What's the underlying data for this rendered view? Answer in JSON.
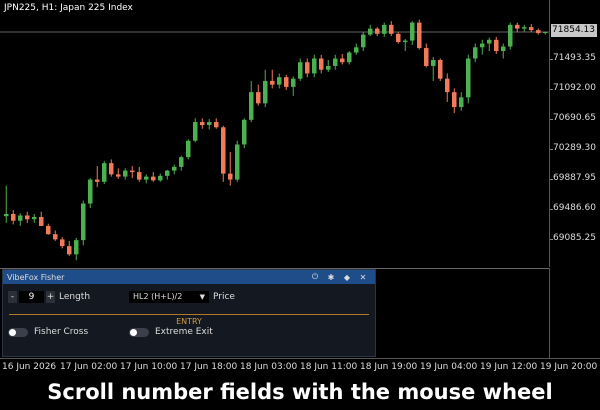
{
  "chart": {
    "title": "JPN225, H1:  Japan 225 Index",
    "current_price": "71854.13",
    "price_levels": [
      "71493.35",
      "71092.00",
      "70690.65",
      "70289.30",
      "69887.95",
      "69486.60",
      "69085.25"
    ],
    "time_labels": [
      "16 Jun 2026",
      "17 Jun 02:00",
      "17 Jun 10:00",
      "17 Jun 18:00",
      "18 Jun 03:00",
      "18 Jun 11:00",
      "18 Jun 19:00",
      "19 Jun 04:00",
      "19 Jun 12:00",
      "19 Jun 20:00"
    ],
    "bull_color": "#4caf50",
    "bear_color": "#f07a5a",
    "candles": [
      {
        "o": 69390,
        "h": 69800,
        "l": 69300,
        "c": 69420
      },
      {
        "o": 69420,
        "h": 69470,
        "l": 69280,
        "c": 69330
      },
      {
        "o": 69330,
        "h": 69430,
        "l": 69260,
        "c": 69400
      },
      {
        "o": 69400,
        "h": 69450,
        "l": 69300,
        "c": 69350
      },
      {
        "o": 69350,
        "h": 69420,
        "l": 69300,
        "c": 69380
      },
      {
        "o": 69380,
        "h": 69450,
        "l": 69320,
        "c": 69260
      },
      {
        "o": 69260,
        "h": 69290,
        "l": 69140,
        "c": 69150
      },
      {
        "o": 69150,
        "h": 69200,
        "l": 69060,
        "c": 69080
      },
      {
        "o": 69080,
        "h": 69110,
        "l": 68960,
        "c": 68990
      },
      {
        "o": 68990,
        "h": 69060,
        "l": 68860,
        "c": 68880
      },
      {
        "o": 68880,
        "h": 69100,
        "l": 68800,
        "c": 69070
      },
      {
        "o": 69070,
        "h": 69600,
        "l": 69000,
        "c": 69560
      },
      {
        "o": 69560,
        "h": 69900,
        "l": 69500,
        "c": 69880
      },
      {
        "o": 69880,
        "h": 70060,
        "l": 69780,
        "c": 69850
      },
      {
        "o": 69850,
        "h": 70130,
        "l": 69820,
        "c": 70100
      },
      {
        "o": 70100,
        "h": 70150,
        "l": 69920,
        "c": 69950
      },
      {
        "o": 69950,
        "h": 70030,
        "l": 69890,
        "c": 69920
      },
      {
        "o": 69920,
        "h": 70030,
        "l": 69880,
        "c": 70000
      },
      {
        "o": 70000,
        "h": 70060,
        "l": 69900,
        "c": 69980
      },
      {
        "o": 69980,
        "h": 70050,
        "l": 69850,
        "c": 69880
      },
      {
        "o": 69880,
        "h": 69950,
        "l": 69830,
        "c": 69920
      },
      {
        "o": 69920,
        "h": 69980,
        "l": 69850,
        "c": 69870
      },
      {
        "o": 69870,
        "h": 69960,
        "l": 69850,
        "c": 69930
      },
      {
        "o": 69930,
        "h": 70010,
        "l": 69880,
        "c": 70000
      },
      {
        "o": 70000,
        "h": 70080,
        "l": 69950,
        "c": 70050
      },
      {
        "o": 70050,
        "h": 70200,
        "l": 70000,
        "c": 70180
      },
      {
        "o": 70180,
        "h": 70420,
        "l": 70150,
        "c": 70400
      },
      {
        "o": 70400,
        "h": 70700,
        "l": 70380,
        "c": 70650
      },
      {
        "o": 70650,
        "h": 70700,
        "l": 70560,
        "c": 70610
      },
      {
        "o": 70610,
        "h": 70690,
        "l": 70550,
        "c": 70650
      },
      {
        "o": 70650,
        "h": 70700,
        "l": 70560,
        "c": 70580
      },
      {
        "o": 70580,
        "h": 70600,
        "l": 69850,
        "c": 69960
      },
      {
        "o": 69960,
        "h": 70250,
        "l": 69800,
        "c": 69880
      },
      {
        "o": 69880,
        "h": 70400,
        "l": 69850,
        "c": 70350
      },
      {
        "o": 70350,
        "h": 70700,
        "l": 70300,
        "c": 70680
      },
      {
        "o": 70680,
        "h": 71200,
        "l": 70650,
        "c": 71050
      },
      {
        "o": 71050,
        "h": 71150,
        "l": 70870,
        "c": 70900
      },
      {
        "o": 70900,
        "h": 71350,
        "l": 70850,
        "c": 71200
      },
      {
        "o": 71200,
        "h": 71350,
        "l": 71100,
        "c": 71150
      },
      {
        "o": 71150,
        "h": 71300,
        "l": 71100,
        "c": 71250
      },
      {
        "o": 71250,
        "h": 71280,
        "l": 71080,
        "c": 71120
      },
      {
        "o": 71120,
        "h": 71260,
        "l": 71000,
        "c": 71230
      },
      {
        "o": 71230,
        "h": 71500,
        "l": 71200,
        "c": 71450
      },
      {
        "o": 71450,
        "h": 71500,
        "l": 71250,
        "c": 71300
      },
      {
        "o": 71300,
        "h": 71550,
        "l": 71250,
        "c": 71500
      },
      {
        "o": 71500,
        "h": 71550,
        "l": 71300,
        "c": 71350
      },
      {
        "o": 71350,
        "h": 71480,
        "l": 71320,
        "c": 71400
      },
      {
        "o": 71400,
        "h": 71550,
        "l": 71350,
        "c": 71500
      },
      {
        "o": 71500,
        "h": 71560,
        "l": 71420,
        "c": 71450
      },
      {
        "o": 71450,
        "h": 71600,
        "l": 71420,
        "c": 71580
      },
      {
        "o": 71580,
        "h": 71700,
        "l": 71550,
        "c": 71650
      },
      {
        "o": 71650,
        "h": 71860,
        "l": 71600,
        "c": 71820
      },
      {
        "o": 71820,
        "h": 71950,
        "l": 71800,
        "c": 71900
      },
      {
        "o": 71900,
        "h": 71920,
        "l": 71800,
        "c": 71830
      },
      {
        "o": 71830,
        "h": 71980,
        "l": 71790,
        "c": 71950
      },
      {
        "o": 71950,
        "h": 72000,
        "l": 71800,
        "c": 71830
      },
      {
        "o": 71830,
        "h": 71850,
        "l": 71700,
        "c": 71720
      },
      {
        "o": 71720,
        "h": 71760,
        "l": 71600,
        "c": 71740
      },
      {
        "o": 71740,
        "h": 72000,
        "l": 71680,
        "c": 71980
      },
      {
        "o": 71980,
        "h": 72020,
        "l": 71620,
        "c": 71640
      },
      {
        "o": 71640,
        "h": 71700,
        "l": 71380,
        "c": 71400
      },
      {
        "o": 71400,
        "h": 71520,
        "l": 71200,
        "c": 71480
      },
      {
        "o": 71480,
        "h": 71500,
        "l": 71200,
        "c": 71230
      },
      {
        "o": 71230,
        "h": 71300,
        "l": 70920,
        "c": 71050
      },
      {
        "o": 71050,
        "h": 71100,
        "l": 70770,
        "c": 70850
      },
      {
        "o": 70850,
        "h": 71050,
        "l": 70800,
        "c": 70980
      },
      {
        "o": 70980,
        "h": 71550,
        "l": 70900,
        "c": 71500
      },
      {
        "o": 71500,
        "h": 71700,
        "l": 71450,
        "c": 71650
      },
      {
        "o": 71650,
        "h": 71750,
        "l": 71550,
        "c": 71700
      },
      {
        "o": 71700,
        "h": 71780,
        "l": 71600,
        "c": 71750
      },
      {
        "o": 71750,
        "h": 71790,
        "l": 71560,
        "c": 71600
      },
      {
        "o": 71600,
        "h": 71700,
        "l": 71500,
        "c": 71660
      },
      {
        "o": 71660,
        "h": 71980,
        "l": 71620,
        "c": 71950
      },
      {
        "o": 71950,
        "h": 71980,
        "l": 71850,
        "c": 71900
      },
      {
        "o": 71900,
        "h": 71950,
        "l": 71860,
        "c": 71920
      },
      {
        "o": 71920,
        "h": 71960,
        "l": 71850,
        "c": 71880
      },
      {
        "o": 71880,
        "h": 71900,
        "l": 71820,
        "c": 71840
      },
      {
        "o": 71840,
        "h": 71860,
        "l": 71820,
        "c": 71854
      }
    ]
  },
  "panel": {
    "title": "VibeFox Fisher",
    "minus": "-",
    "length_value": "9",
    "plus": "+",
    "length_label": "Length",
    "source_value": "HL2 (H+L)/2",
    "price_label": "Price",
    "entry_label": "ENTRY",
    "fisher_cross_label": "Fisher Cross",
    "extreme_exit_label": "Extreme Exit"
  },
  "caption": "Scroll number fields with the mouse wheel"
}
